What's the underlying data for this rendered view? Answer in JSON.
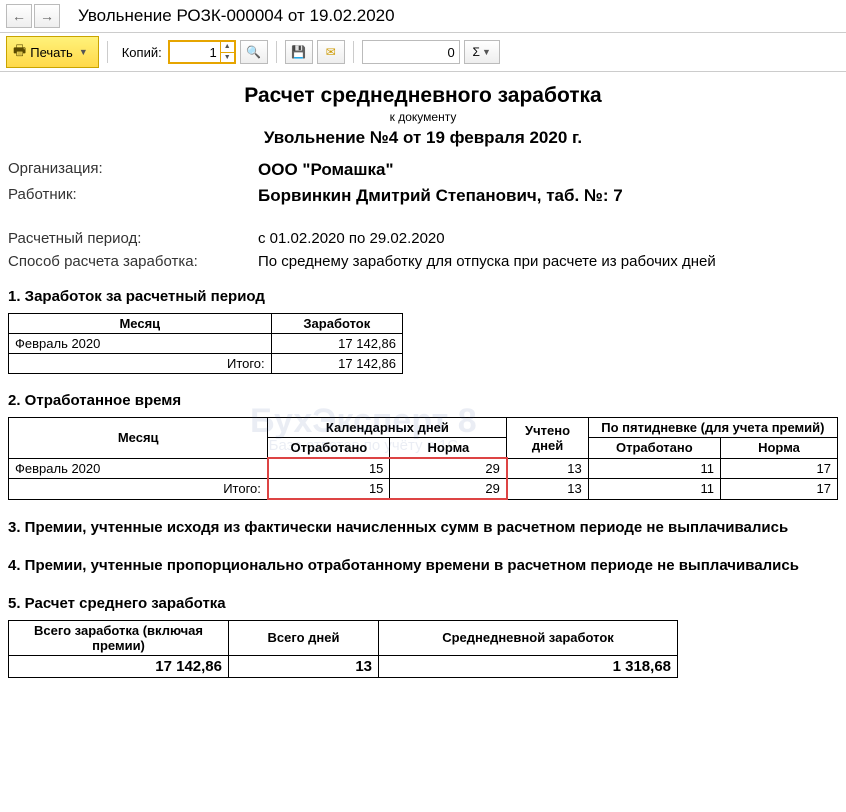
{
  "header": {
    "title": "Увольнение РОЗК-000004 от 19.02.2020"
  },
  "toolbar": {
    "print_label": "Печать",
    "copies_label": "Копий:",
    "copies_value": "1",
    "num_value": "0",
    "sigma_label": "Σ"
  },
  "report": {
    "title": "Расчет среднедневного заработка",
    "subtitle_small": "к документу",
    "subtitle_doc": "Увольнение №4 от 19 февраля 2020 г.",
    "org_label": "Организация:",
    "org_value": "ООО \"Ромашка\"",
    "emp_label": "Работник:",
    "emp_value": "Борвинкин Дмитрий Степанович, таб. №: 7",
    "period_label": "Расчетный период:",
    "period_value": "с 01.02.2020 по 29.02.2020",
    "method_label": "Способ расчета заработка:",
    "method_value": "По среднему заработку для отпуска при расчете из рабочих дней"
  },
  "sec1": {
    "title": "1. Заработок за расчетный период",
    "h_month": "Месяц",
    "h_earn": "Заработок",
    "row_month": "Февраль 2020",
    "row_val": "17 142,86",
    "total_label": "Итого:",
    "total_val": "17 142,86"
  },
  "sec2": {
    "title": "2. Отработанное время",
    "h_month": "Месяц",
    "h_cal": "Календарных дней",
    "h_uch": "Учтено дней",
    "h_pyat": "По пятидневке (для учета премий)",
    "h_otr": "Отработано",
    "h_norm": "Норма",
    "row_month": "Февраль 2020",
    "r_otr": "15",
    "r_norm": "29",
    "r_uch": "13",
    "r_potr": "11",
    "r_pnorm": "17",
    "total_label": "Итого:",
    "t_otr": "15",
    "t_norm": "29",
    "t_uch": "13",
    "t_potr": "11",
    "t_pnorm": "17"
  },
  "sec3": {
    "title": "3. Премии, учтенные исходя из фактически начисленных сумм в расчетном периоде не выплачивались"
  },
  "sec4": {
    "title": "4. Премии, учтенные пропорционально отработанному времени в расчетном периоде не выплачивались"
  },
  "sec5": {
    "title": "5. Расчет среднего  заработка",
    "h1": "Всего заработка (включая премии)",
    "h2": "Всего дней",
    "h3": "Среднедневной заработок",
    "v1": "17 142,86",
    "v2": "13",
    "v3": "1 318,68"
  },
  "watermark": {
    "big": "БухЭксперт 8",
    "small": "База ответов по учёту в 1С"
  }
}
